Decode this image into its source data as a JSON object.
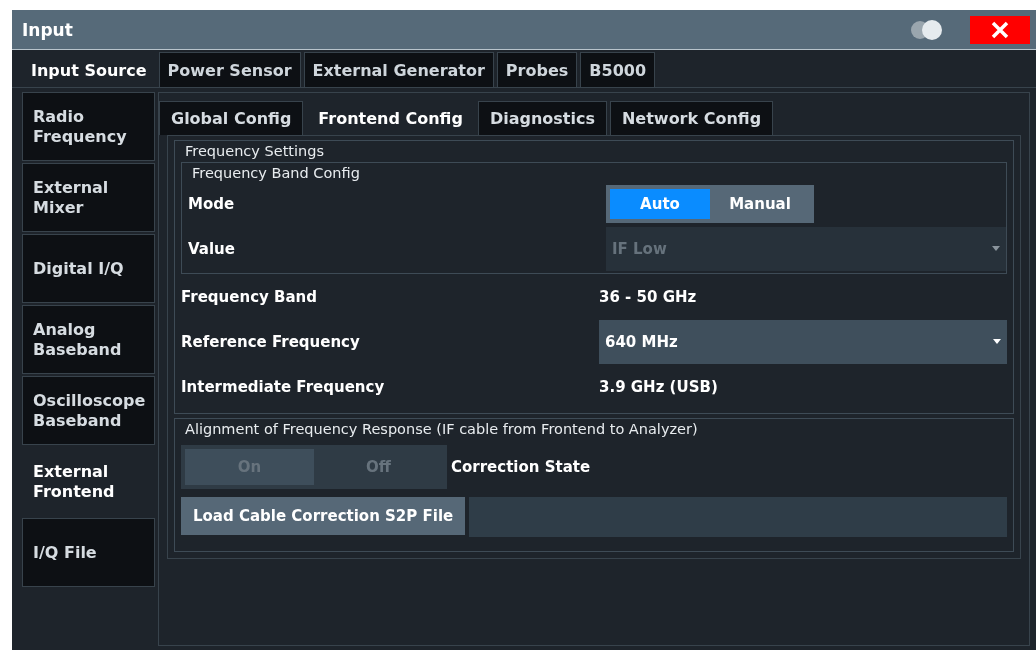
{
  "window": {
    "title": "Input",
    "display_toggle": {
      "on": true
    }
  },
  "tabs": [
    {
      "label": "Input Source",
      "selected": true
    },
    {
      "label": "Power Sensor",
      "selected": false
    },
    {
      "label": "External Generator",
      "selected": false
    },
    {
      "label": "Probes",
      "selected": false
    },
    {
      "label": "B5000",
      "selected": false
    }
  ],
  "sidebar": {
    "items": [
      {
        "label": "Radio Frequency",
        "selected": false
      },
      {
        "label": "External Mixer",
        "selected": false
      },
      {
        "label": "Digital I/Q",
        "selected": false
      },
      {
        "label": "Analog Baseband",
        "selected": false
      },
      {
        "label": "Oscilloscope Baseband",
        "selected": false
      },
      {
        "label": "External Frontend",
        "selected": true
      },
      {
        "label": "I/Q File",
        "selected": false
      }
    ]
  },
  "subtabs": [
    {
      "label": "Global Config",
      "selected": false
    },
    {
      "label": "Frontend Config",
      "selected": true
    },
    {
      "label": "Diagnostics",
      "selected": false
    },
    {
      "label": "Network Config",
      "selected": false
    }
  ],
  "frequency_settings": {
    "title": "Frequency Settings",
    "band_config": {
      "title": "Frequency Band Config",
      "rows": [
        {
          "kind": "toggle",
          "label": "Mode",
          "disabled": false,
          "options": [
            {
              "label": "Auto",
              "selected": true
            },
            {
              "label": "Manual",
              "selected": false
            }
          ]
        },
        {
          "kind": "dropdown",
          "label": "Value",
          "value": "IF Low",
          "disabled": true
        }
      ]
    },
    "rows": [
      {
        "kind": "text",
        "label": "Frequency Band",
        "value": "36 - 50 GHz"
      },
      {
        "kind": "dropdown",
        "label": "Reference Frequency",
        "value": "640 MHz",
        "disabled": false
      },
      {
        "kind": "text",
        "label": "Intermediate Frequency",
        "value": "3.9 GHz (USB)"
      }
    ]
  },
  "alignment": {
    "title": "Alignment of Frequency Response (IF cable from Frontend to Analyzer)",
    "correction_state": {
      "label": "Correction State",
      "disabled": true,
      "options": [
        {
          "label": "On",
          "selected": true
        },
        {
          "label": "Off",
          "selected": false
        }
      ]
    },
    "load_button": "Load Cable Correction S2P File"
  }
}
